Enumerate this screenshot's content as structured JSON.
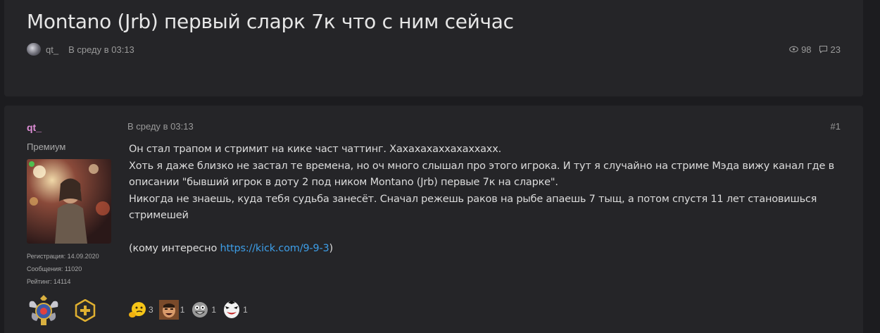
{
  "thread": {
    "title": "Montano (Jrb) первый сларк 7к что с ним сейчас",
    "author": "qt_",
    "date": "В среду в 03:13",
    "views": "98",
    "replies": "23"
  },
  "post": {
    "author": {
      "name": "qt_",
      "title": "Премиум",
      "registration": "Регистрация: 14.09.2020",
      "messages": "Сообщения: 11020",
      "rating": "Рейтинг: 14114",
      "online": true
    },
    "date": "В среду в 03:13",
    "number": "#1",
    "lines": [
      "Он стал трапом и стримит на кике част чаттинг. Хахахахаххахаххахх.",
      "Хоть я даже близко не застал те времена, но оч много слышал про этого игрока. И тут я случайно на стриме Мэда вижу канал где в описании \"бывший игрок в доту 2 под ником Montano (Jrb) первые 7к на сларке\".",
      "Никогда не знаешь, куда тебя судьба занесёт. Сначал режешь раков на рыбе апаешь 7 тыщ, а потом спустя 11 лет становишься стримешей"
    ],
    "link_prefix": "(кому интересно ",
    "link_text": "https://kick.com/9-9-3",
    "link_suffix": ")",
    "reactions": [
      {
        "icon": "thinking-emoji-icon",
        "count": "3"
      },
      {
        "icon": "laughing-man-icon",
        "count": "1"
      },
      {
        "icon": "grinning-face-icon",
        "count": "1"
      },
      {
        "icon": "clown-mask-icon",
        "count": "1"
      }
    ]
  },
  "colors": {
    "background": "#1c1c1f",
    "panel": "#252528",
    "username": "#e08fd8",
    "link": "#3d9ee8",
    "online": "#4fbf4f"
  }
}
